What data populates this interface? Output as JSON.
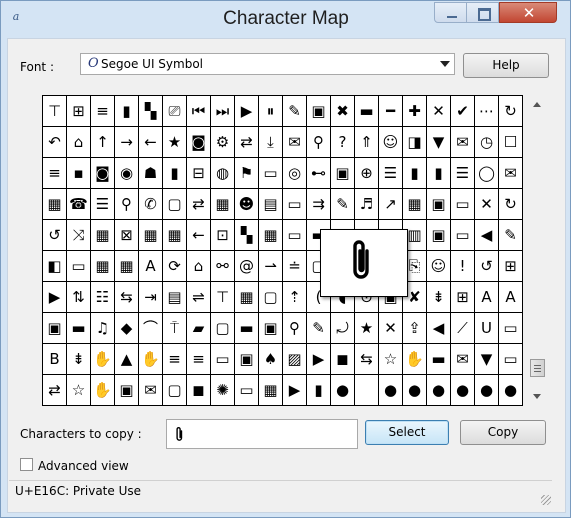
{
  "window": {
    "title": "Character Map",
    "min_glyph": "–",
    "max_glyph": "",
    "close_glyph": "✕"
  },
  "font": {
    "label": "Font :",
    "icon": "O",
    "value": "Segoe UI Symbol"
  },
  "buttons": {
    "help": "Help",
    "select": "Select",
    "copy": "Copy"
  },
  "grid": {
    "rows": [
      [
        "⊤",
        "⊞",
        "≡",
        "▮",
        "▚",
        "⎚",
        "⏮",
        "⏭",
        "▶",
        "⏸",
        "✎",
        "▣",
        "✖",
        "▬",
        "━",
        "✚",
        "✕",
        "✔",
        "⋯",
        "↻"
      ],
      [
        "↶",
        "⌂",
        "↑",
        "→",
        "←",
        "★",
        "◙",
        "⚙",
        "⇄",
        "⤓",
        "✉",
        "⚲",
        "?",
        "⇑",
        "☺",
        "◨",
        "▼",
        "✉",
        "◷",
        "☐"
      ],
      [
        "≡",
        "▪",
        "◙",
        "◉",
        "☗",
        "▮",
        "⊟",
        "◍",
        "⚑",
        "▭",
        "◎",
        "⊷",
        "▣",
        "⊕",
        "☰",
        "▮",
        "▮",
        "☰",
        "◯",
        "✉"
      ],
      [
        "▦",
        "☎",
        "☰",
        "⚲",
        "✆",
        "▢",
        "⇄",
        "▦",
        "☻",
        "▤",
        "▭",
        "⇉",
        "✎",
        "♬",
        "↗",
        "▦",
        "▣",
        "▭",
        "✕",
        "↻"
      ],
      [
        "↺",
        "⤨",
        "▦",
        "⊠",
        "▦",
        "▦",
        "←",
        "⊡",
        "▚",
        "▦",
        "▭",
        "▬",
        "▣",
        "▤",
        "▦",
        "▥",
        "▣",
        "▭",
        "◀",
        "✎"
      ],
      [
        "◧",
        "▭",
        "▦",
        "▦",
        "A",
        "⟳",
        "⌂",
        "⚯",
        "@",
        "⇀",
        "≐",
        "▢",
        "▦",
        "▨",
        "▼",
        "⎘",
        "☺",
        "!",
        "↺",
        "⊞"
      ],
      [
        "▶",
        "⇅",
        "☷",
        "⇆",
        "⇥",
        "▤",
        "⇌",
        "⊤",
        "▦",
        "▢",
        "⇡",
        "(",
        "◖",
        "⊙",
        "▣",
        "✘",
        "⇟",
        "⊞",
        "A",
        "A"
      ],
      [
        "▣",
        "▬",
        "♫",
        "◆",
        "⌒",
        "⍑",
        "▰",
        "▢",
        "▬",
        "▣",
        "⚲",
        "✎",
        "⤾",
        "★",
        "✕",
        "⇪",
        "◀",
        "⟋",
        "U",
        "▭"
      ],
      [
        "B",
        "⇟",
        "✋",
        "▲",
        "✋",
        "≡",
        "≡",
        "▭",
        "▣",
        "♠",
        "▨",
        "▶",
        "◼",
        "⇆",
        "☆",
        "✋",
        "▬",
        "✉",
        "▼",
        "▭"
      ],
      [
        "⇄",
        "☆",
        "✋",
        "▣",
        "✉",
        "▢",
        "◼",
        "✺",
        "▭",
        "▦",
        "▶",
        "▮",
        "●",
        "",
        "●",
        "●",
        "●",
        "●",
        "●",
        "●"
      ]
    ]
  },
  "zoom_char_name": "paperclip-icon",
  "copy": {
    "label": "Characters to copy :",
    "value": ""
  },
  "advanced": {
    "label": "Advanced view",
    "checked": false
  },
  "status": "U+E16C: Private Use"
}
